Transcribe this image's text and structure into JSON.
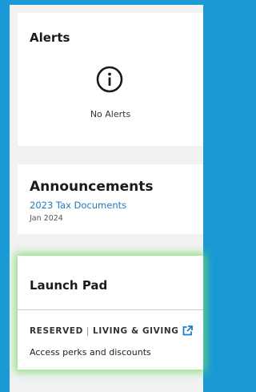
{
  "alerts": {
    "title": "Alerts",
    "icon": "info-icon",
    "empty_text": "No Alerts"
  },
  "announcements": {
    "title": "Announcements",
    "link_text": "2023 Tax Documents",
    "date": "Jan 2024"
  },
  "launch_pad": {
    "title": "Launch Pad",
    "brand_primary": "RESERVED",
    "brand_separator": "|",
    "brand_secondary": "LIVING & GIVING",
    "brand_icon": "external-link-icon",
    "description": "Access perks and discounts"
  },
  "colors": {
    "background": "#1a9ad6",
    "panel": "#f1f2f4",
    "link": "#1d7ccf",
    "highlight_glow": "#78dc64"
  }
}
